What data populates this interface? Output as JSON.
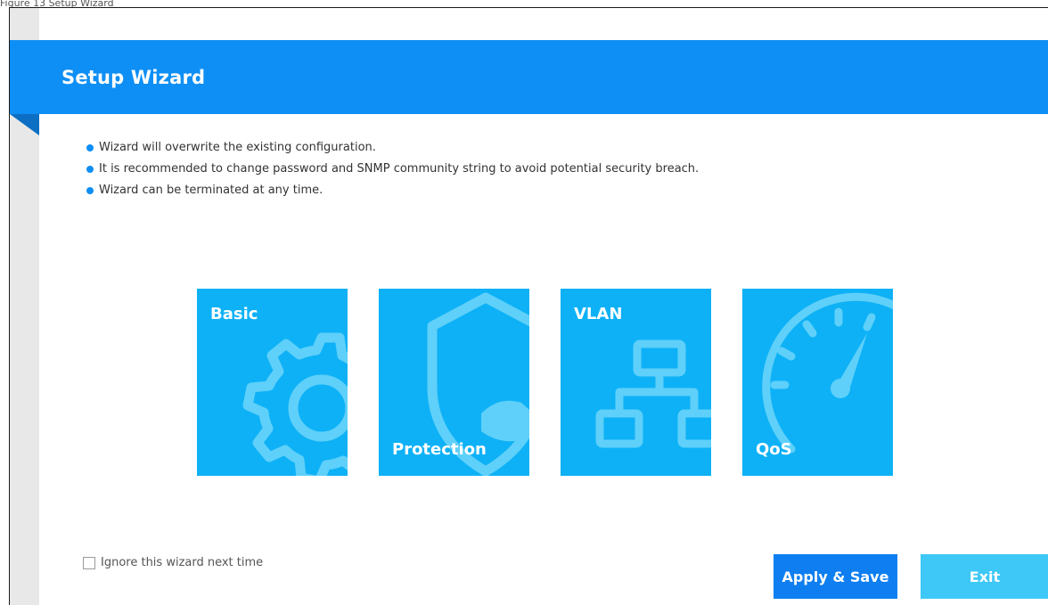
{
  "caption": "Figure 13   Setup Wizard",
  "header": {
    "title": "Setup Wizard"
  },
  "notes": [
    "Wizard will overwrite the existing configuration.",
    "It is recommended to change password and SNMP community string to avoid potential security breach.",
    "Wizard can be terminated at any time."
  ],
  "tiles": {
    "basic": {
      "label": "Basic",
      "icon": "gear-icon"
    },
    "protection": {
      "label": "Protection",
      "icon": "shield-icon"
    },
    "vlan": {
      "label": "VLAN",
      "icon": "network-topology-icon"
    },
    "qos": {
      "label": "QoS",
      "icon": "speedometer-icon"
    }
  },
  "footer": {
    "ignore_label": "Ignore this wizard next time",
    "ignore_checked": false,
    "apply_label": "Apply & Save",
    "exit_label": "Exit"
  },
  "colors": {
    "header": "#0e8ff5",
    "tile": "#0eb1f6",
    "apply": "#0e7ef0",
    "exit": "#3ec8f7"
  }
}
